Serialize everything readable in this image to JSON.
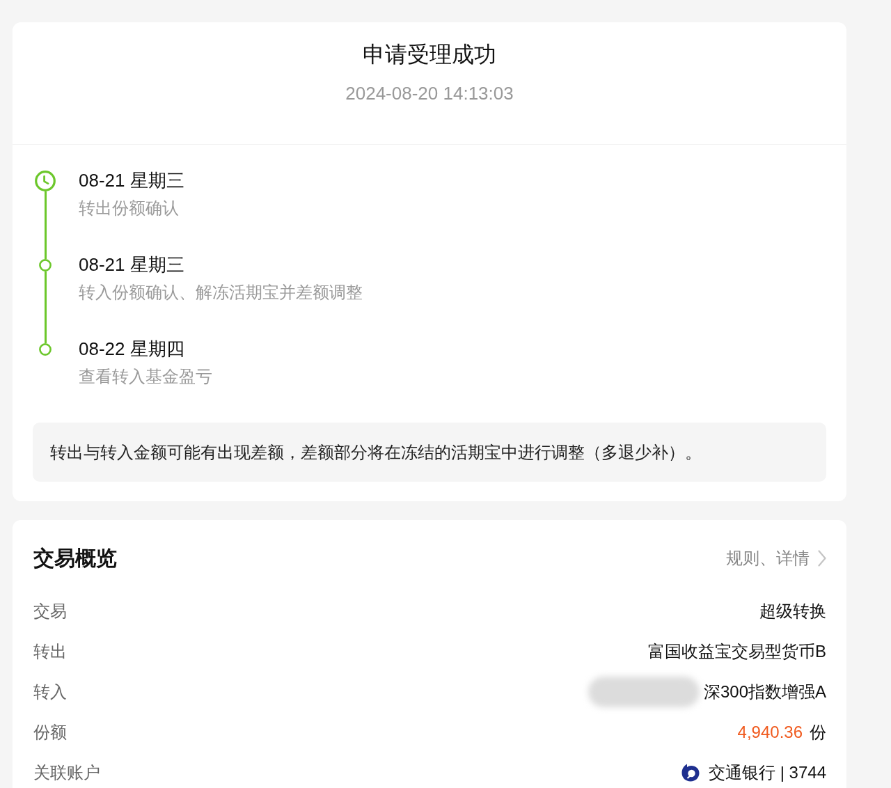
{
  "result": {
    "title": "申请受理成功",
    "time": "2024-08-20 14:13:03"
  },
  "timeline": [
    {
      "date": "08-21 星期三",
      "description": "转出份额确认",
      "current": true
    },
    {
      "date": "08-21 星期三",
      "description": "转入份额确认、解冻活期宝并差额调整",
      "current": false
    },
    {
      "date": "08-22 星期四",
      "description": "查看转入基金盈亏",
      "current": false
    }
  ],
  "notice": "转出与转入金额可能有出现差额，差额部分将在冻结的活期宝中进行调整（多退少补）。",
  "overview": {
    "title": "交易概览",
    "link": "规则、详情",
    "rows": [
      {
        "kind": "text",
        "label": "交易",
        "value": "超级转换"
      },
      {
        "kind": "text",
        "label": "转出",
        "value": "富国收益宝交易型货币B"
      },
      {
        "kind": "redacted",
        "label": "转入",
        "value": "深300指数增强A"
      },
      {
        "kind": "amount",
        "label": "份额",
        "value": "4,940.36",
        "unit": "份"
      },
      {
        "kind": "account",
        "label": "关联账户",
        "value": "交通银行 | 3744"
      }
    ]
  }
}
